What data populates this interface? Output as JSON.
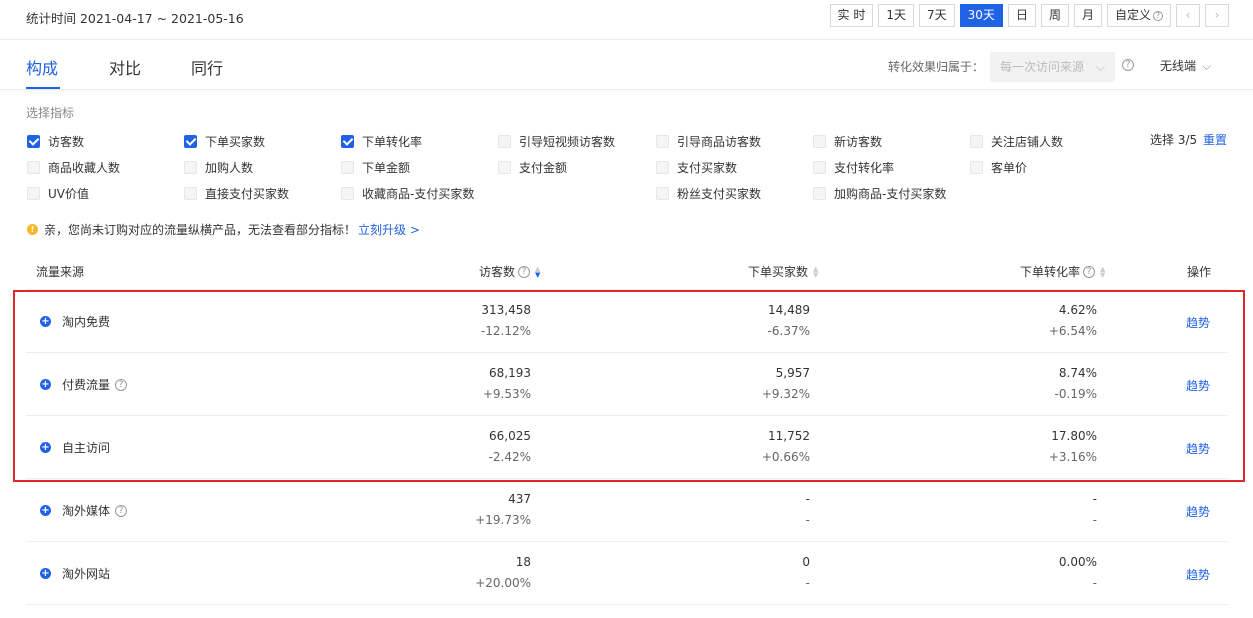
{
  "header": {
    "date_range": "统计时间 2021-04-17 ~ 2021-05-16",
    "time_buttons": [
      "实 时",
      "1天",
      "7天",
      "30天",
      "日",
      "周",
      "月",
      "自定义"
    ],
    "prev_icon": "chevron-left-icon",
    "next_icon": "chevron-right-icon",
    "accent_color": "#2062e6"
  },
  "tabs": {
    "items": [
      "构成",
      "对比",
      "同行"
    ],
    "active": "构成",
    "attribution_label": "转化效果归属于：",
    "attribution_value": "每一次访问来源",
    "device": "无线端"
  },
  "metrics": {
    "title": "选择指标",
    "selected_count": "选择 3/5",
    "reset": "重置",
    "items": [
      {
        "label": "访客数",
        "state": "checked"
      },
      {
        "label": "下单买家数",
        "state": "checked"
      },
      {
        "label": "下单转化率",
        "state": "checked"
      },
      {
        "label": "引导短视频访客数",
        "state": "disabled"
      },
      {
        "label": "引导商品访客数",
        "state": "disabled"
      },
      {
        "label": "新访客数",
        "state": "disabled"
      },
      {
        "label": "关注店铺人数",
        "state": "disabled"
      },
      {
        "label": "商品收藏人数",
        "state": "disabled"
      },
      {
        "label": "加购人数",
        "state": "disabled"
      },
      {
        "label": "下单金额",
        "state": "disabled"
      },
      {
        "label": "支付金额",
        "state": "disabled"
      },
      {
        "label": "支付买家数",
        "state": "disabled"
      },
      {
        "label": "支付转化率",
        "state": "disabled"
      },
      {
        "label": "客单价",
        "state": "disabled"
      },
      {
        "label": "UV价值",
        "state": "disabled"
      },
      {
        "label": "直接支付买家数",
        "state": "disabled"
      },
      {
        "label": "收藏商品-支付买家数",
        "state": "disabled"
      },
      {
        "label": "粉丝支付买家数",
        "state": "disabled"
      },
      {
        "label": "加购商品-支付买家数",
        "state": "disabled"
      }
    ]
  },
  "notice": {
    "text": "亲，您尚未订购对应的流量纵横产品，无法查看部分指标！",
    "link": "立刻升级 >"
  },
  "table": {
    "columns": [
      "流量来源",
      "访客数",
      "下单买家数",
      "下单转化率",
      "操作"
    ],
    "trend_label": "趋势",
    "rows": [
      {
        "source": "淘内免费",
        "has_help": false,
        "visitors": "313,458",
        "visitors_change": "-12.12%",
        "buyers": "14,489",
        "buyers_change": "-6.37%",
        "rate": "4.62%",
        "rate_change": "+6.54%"
      },
      {
        "source": "付费流量",
        "has_help": true,
        "visitors": "68,193",
        "visitors_change": "+9.53%",
        "buyers": "5,957",
        "buyers_change": "+9.32%",
        "rate": "8.74%",
        "rate_change": "-0.19%"
      },
      {
        "source": "自主访问",
        "has_help": false,
        "visitors": "66,025",
        "visitors_change": "-2.42%",
        "buyers": "11,752",
        "buyers_change": "+0.66%",
        "rate": "17.80%",
        "rate_change": "+3.16%"
      },
      {
        "source": "淘外媒体",
        "has_help": true,
        "visitors": "437",
        "visitors_change": "+19.73%",
        "buyers": "-",
        "buyers_change": "-",
        "rate": "-",
        "rate_change": "-"
      },
      {
        "source": "淘外网站",
        "has_help": false,
        "visitors": "18",
        "visitors_change": "+20.00%",
        "buyers": "0",
        "buyers_change": "-",
        "rate": "0.00%",
        "rate_change": "-"
      }
    ]
  },
  "highlight_color": "#e0272d"
}
